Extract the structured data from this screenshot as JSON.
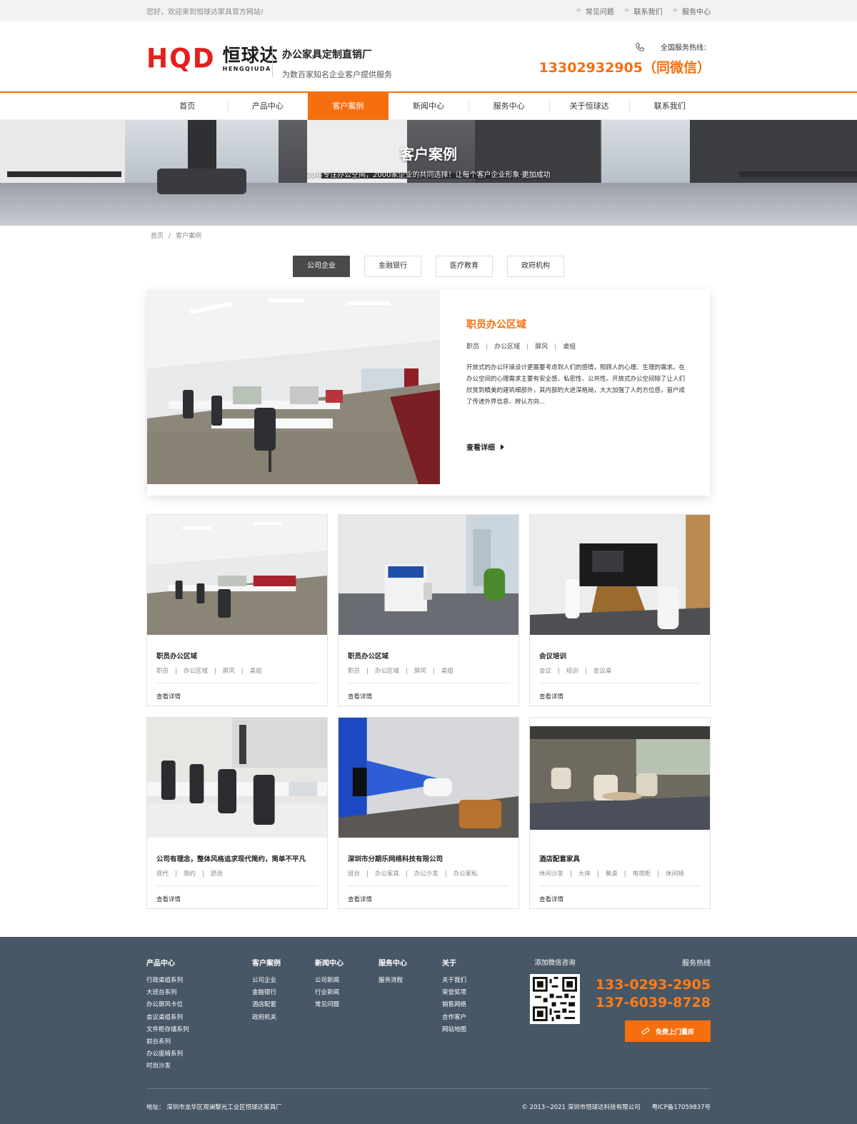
{
  "topbar": {
    "welcome": "您好，欢迎来到恒球达家具官方网站!",
    "links": [
      "常见问题",
      "联系我们",
      "服务中心"
    ],
    "star": "※"
  },
  "header": {
    "logo_letters": "HQD",
    "logo_cn": "恒球达",
    "logo_en": "HENGQIUDA",
    "slogan_title": "办公家具定制直销厂",
    "slogan_sub": "为数百家知名企业客户提供服务",
    "hotline_label": "全国服务热线：",
    "hotline_number": "13302932905（同微信）"
  },
  "nav": [
    "首页",
    "产品中心",
    "客户案例",
    "新闻中心",
    "服务中心",
    "关于恒球达",
    "联系我们"
  ],
  "nav_active": "客户案例",
  "banner": {
    "title": "客户案例",
    "subtitle": "20年专注办公空间，2000家企业的共同选择！让每个客户企业形象·更加成功"
  },
  "breadcrumb": {
    "home": "首页",
    "sep": "/",
    "current": "客户案例"
  },
  "tabs": [
    "公司企业",
    "金融银行",
    "医疗教育",
    "政府机构"
  ],
  "feature": {
    "title": "职员办公区域",
    "tags": [
      "职员",
      "办公区域",
      "屏风",
      "桌组"
    ],
    "desc": "开放式的办公环境设计更需要考虑到人们的感情，照顾人的心理、生理的需求。在办公空间的心理需求主要有安全感、私密性、公共性。开放式办公空间除了让人们欣赏到精美的建筑细部外，其内部的大进深格局，大大加强了人的方位感，窗户成了传递外界信息、辨认方向...",
    "more": "查看详细"
  },
  "cards": [
    {
      "title": "职员办公区域",
      "tags": [
        "职员",
        "办公区域",
        "屏风",
        "桌组"
      ],
      "more": "查看详情"
    },
    {
      "title": "职员办公区域",
      "tags": [
        "职员",
        "办公区域",
        "屏风",
        "桌组"
      ],
      "more": "查看详情"
    },
    {
      "title": "会议培训",
      "tags": [
        "会议",
        "培训",
        "会议桌"
      ],
      "more": "查看详情"
    },
    {
      "title": "公司有理念，整体风格追求现代简约，简单不平凡",
      "tags": [
        "现代",
        "简约",
        "舒适"
      ],
      "more": "查看详情"
    },
    {
      "title": "深圳市分期乐网络科技有限公司",
      "tags": [
        "班台",
        "办公家具",
        "办公沙发",
        "办公家私"
      ],
      "more": "查看详情"
    },
    {
      "title": "酒店配套家具",
      "tags": [
        "休闲沙发",
        "大床",
        "餐桌",
        "电视柜",
        "休闲椅"
      ],
      "more": "查看详情"
    }
  ],
  "footer": {
    "columns": [
      {
        "heading": "产品中心",
        "links": [
          "行政桌组系列",
          "大班台系列",
          "办公屏风卡位",
          "会议桌组系列",
          "文件柜存储系列",
          "前台系列",
          "办公座椅系列",
          "时尚沙发"
        ]
      },
      {
        "heading": "客户案例",
        "links": [
          "公司企业",
          "金融银行",
          "酒店配套",
          "政府机关"
        ]
      },
      {
        "heading": "新闻中心",
        "links": [
          "公司新闻",
          "行业新闻",
          "常见问题"
        ]
      },
      {
        "heading": "服务中心",
        "links": [
          "服务流程"
        ]
      },
      {
        "heading": "关于",
        "links": [
          "关于我们",
          "荣誉奖项",
          "销售网络",
          "合作客户",
          "网站地图"
        ]
      }
    ],
    "wechat_label": "添加微信咨询",
    "service_label": "服务热线",
    "phones": [
      "133-0293-2905",
      "137-6039-8728"
    ],
    "cta": "免费上门量房",
    "address": "地址：  深圳市龙华区观澜黎光工业区恒球达家具厂",
    "copyright": "© 2013~2021 深圳市恒球达科技有限公司",
    "icp": "粤ICP备17059837号"
  },
  "colors": {
    "accent": "#f66f0f",
    "logo_red": "#e51f1f",
    "footer_bg": "#475766",
    "tab_active": "#4a4a4a"
  }
}
